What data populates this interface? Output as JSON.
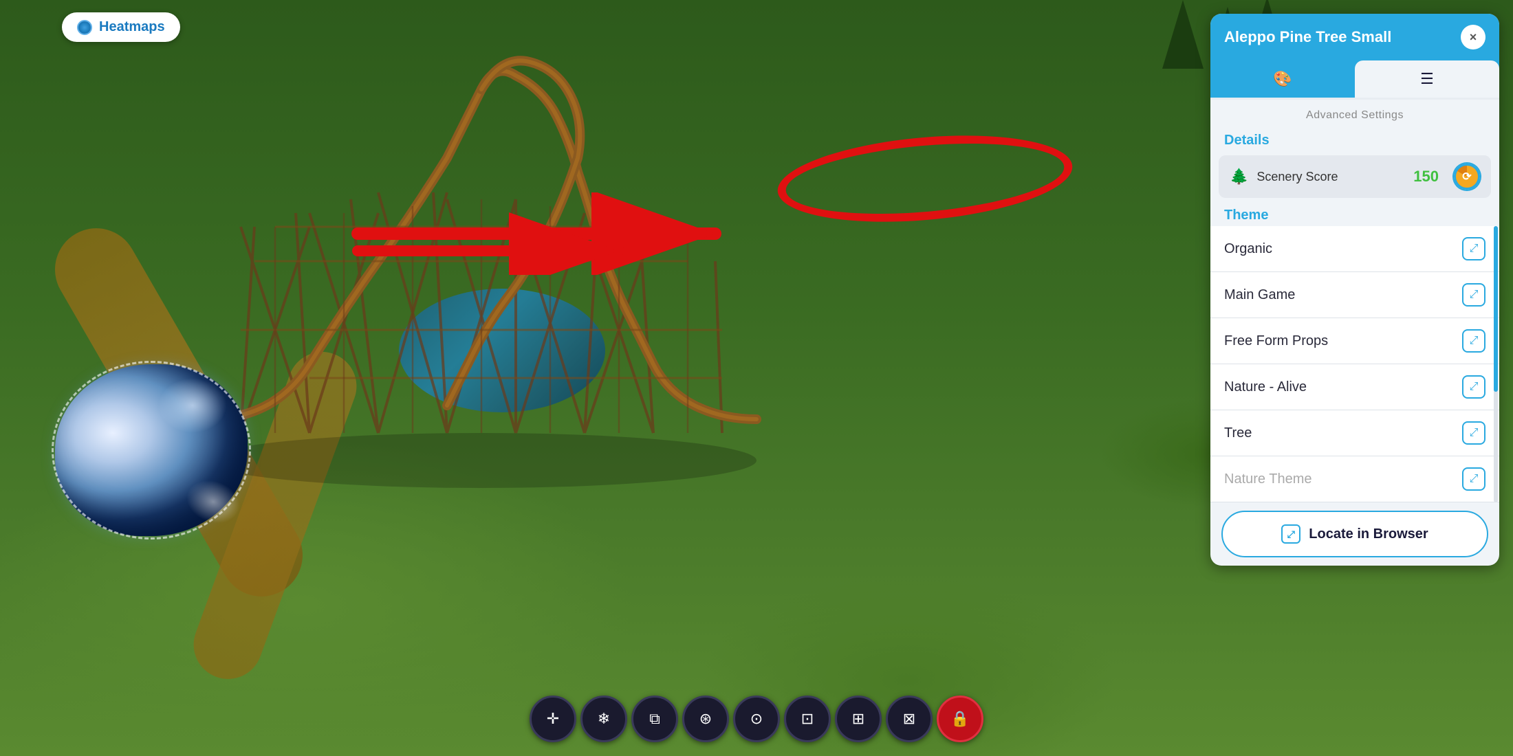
{
  "heatmaps": {
    "label": "Heatmaps"
  },
  "panel": {
    "title": "Aleppo Pine Tree Small",
    "close_label": "×",
    "tabs": [
      {
        "id": "paint",
        "label": "🎨",
        "active": true
      },
      {
        "id": "list",
        "label": "≡",
        "active": false
      }
    ],
    "section_label": "Advanced Settings",
    "details_header": "Details",
    "scenery_score": {
      "label": "Scenery Score",
      "value": "150"
    },
    "themes_header": "Theme",
    "theme_items": [
      {
        "name": "Organic"
      },
      {
        "name": "Main Game"
      },
      {
        "name": "Free Form Props"
      },
      {
        "name": "Nature - Alive"
      },
      {
        "name": "Tree"
      },
      {
        "name": "Nature Theme"
      }
    ],
    "locate_btn": {
      "label": "Locate in Browser"
    }
  },
  "toolbar": {
    "buttons": [
      {
        "icon": "✛",
        "label": "move"
      },
      {
        "icon": "❄",
        "label": "freeze"
      },
      {
        "icon": "⧉",
        "label": "copy"
      },
      {
        "icon": "⊛",
        "label": "freeze-copy"
      },
      {
        "icon": "⊙",
        "label": "locate"
      },
      {
        "icon": "⊡",
        "label": "export"
      },
      {
        "icon": "⊞",
        "label": "grid"
      },
      {
        "icon": "⊠",
        "label": "export2"
      },
      {
        "icon": "🔒",
        "label": "lock"
      }
    ]
  },
  "annotation": {
    "arrow_visible": true,
    "circle_visible": true
  }
}
